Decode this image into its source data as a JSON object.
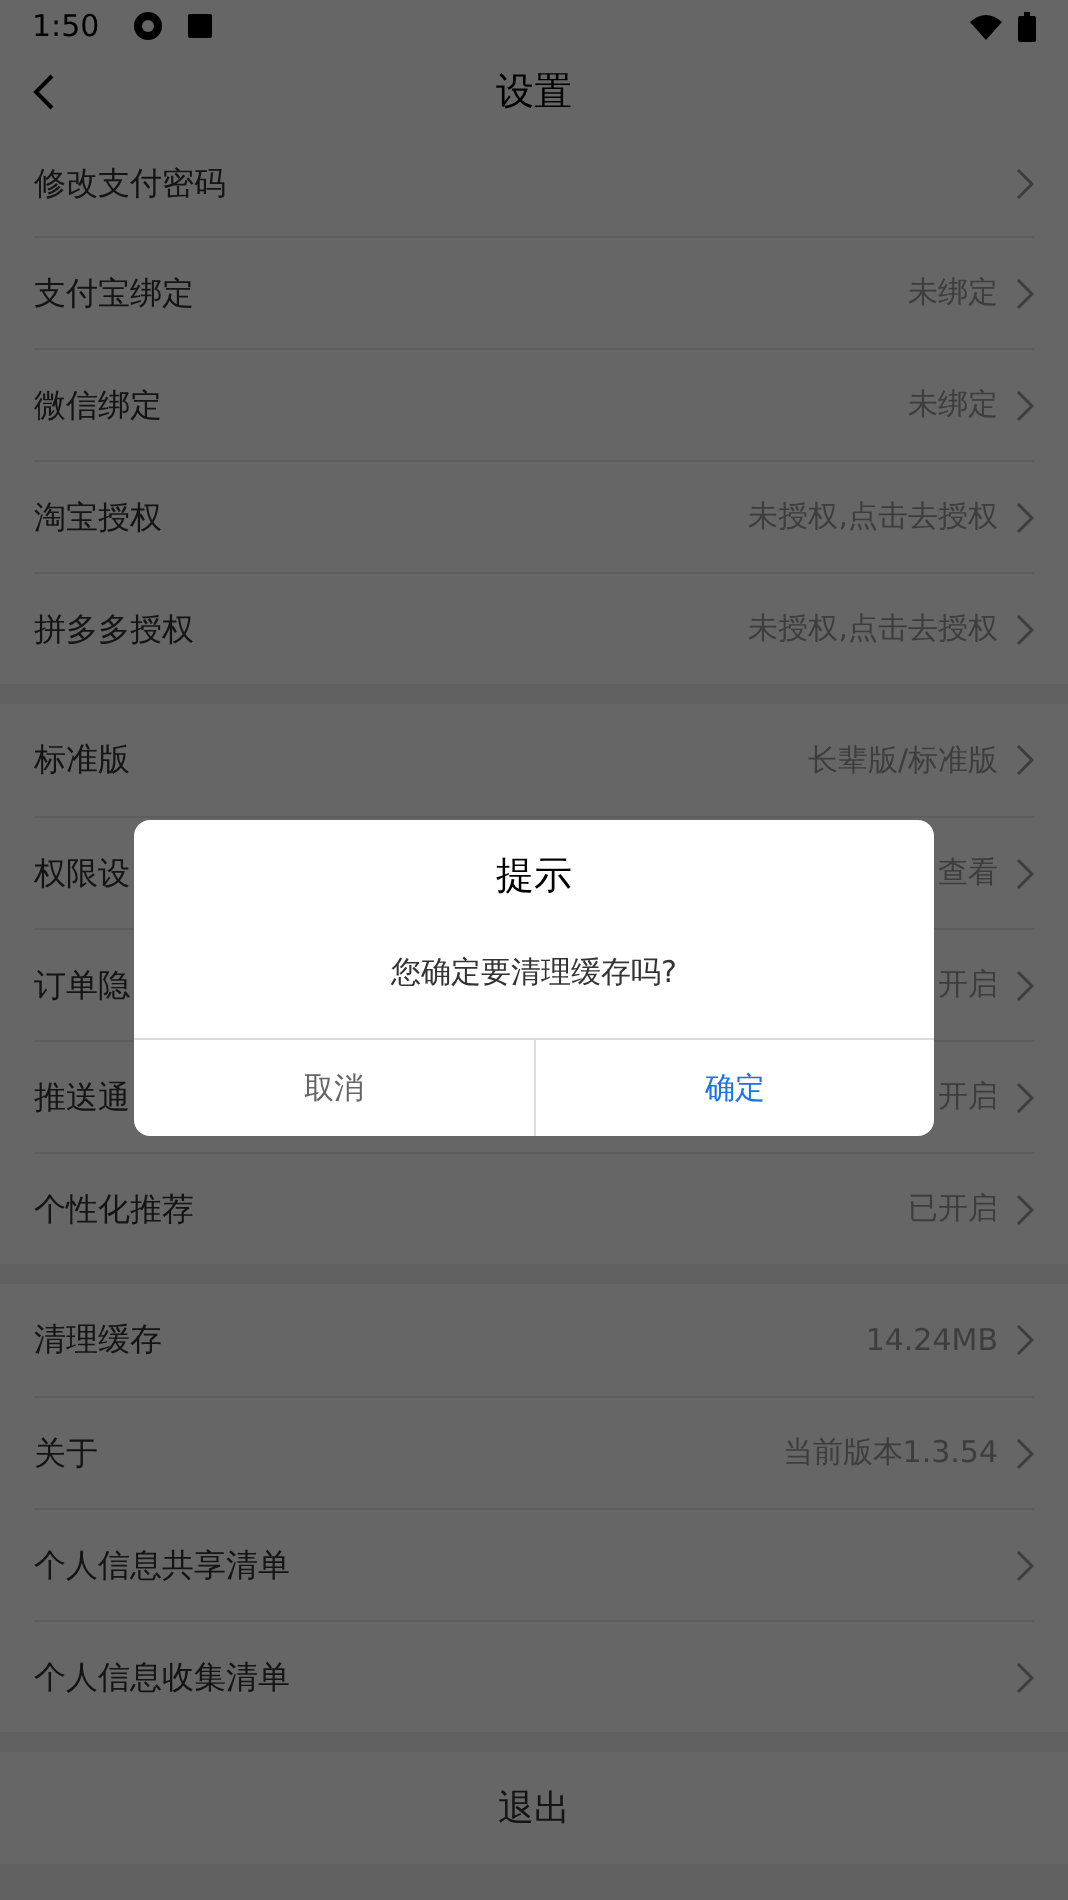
{
  "status_bar": {
    "time": "1:50"
  },
  "header": {
    "title": "设置"
  },
  "groups": [
    {
      "rows": [
        {
          "label": "修改支付密码"
        },
        {
          "label": "支付宝绑定",
          "value": "未绑定"
        },
        {
          "label": "微信绑定",
          "value": "未绑定"
        },
        {
          "label": "淘宝授权",
          "value": "未授权,点击去授权"
        },
        {
          "label": "拼多多授权",
          "value": "未授权,点击去授权"
        }
      ]
    },
    {
      "rows": [
        {
          "label": "标准版",
          "value": "长辈版/标准版"
        },
        {
          "label": "权限设",
          "value": "查看"
        },
        {
          "label": "订单隐",
          "value": "开启"
        },
        {
          "label": "推送通",
          "value": "开启"
        },
        {
          "label": "个性化推荐",
          "value": "已开启"
        }
      ]
    },
    {
      "rows": [
        {
          "label": "清理缓存",
          "value": "14.24MB"
        },
        {
          "label": "关于",
          "value": "当前版本1.3.54"
        },
        {
          "label": "个人信息共享清单"
        },
        {
          "label": "个人信息收集清单"
        }
      ]
    }
  ],
  "logout": "退出",
  "dialog": {
    "title": "提示",
    "message": "您确定要清理缓存吗?",
    "buttons": [
      {
        "label": "取消",
        "kind": "cancel"
      },
      {
        "label": "确定",
        "kind": "confirm"
      }
    ]
  }
}
